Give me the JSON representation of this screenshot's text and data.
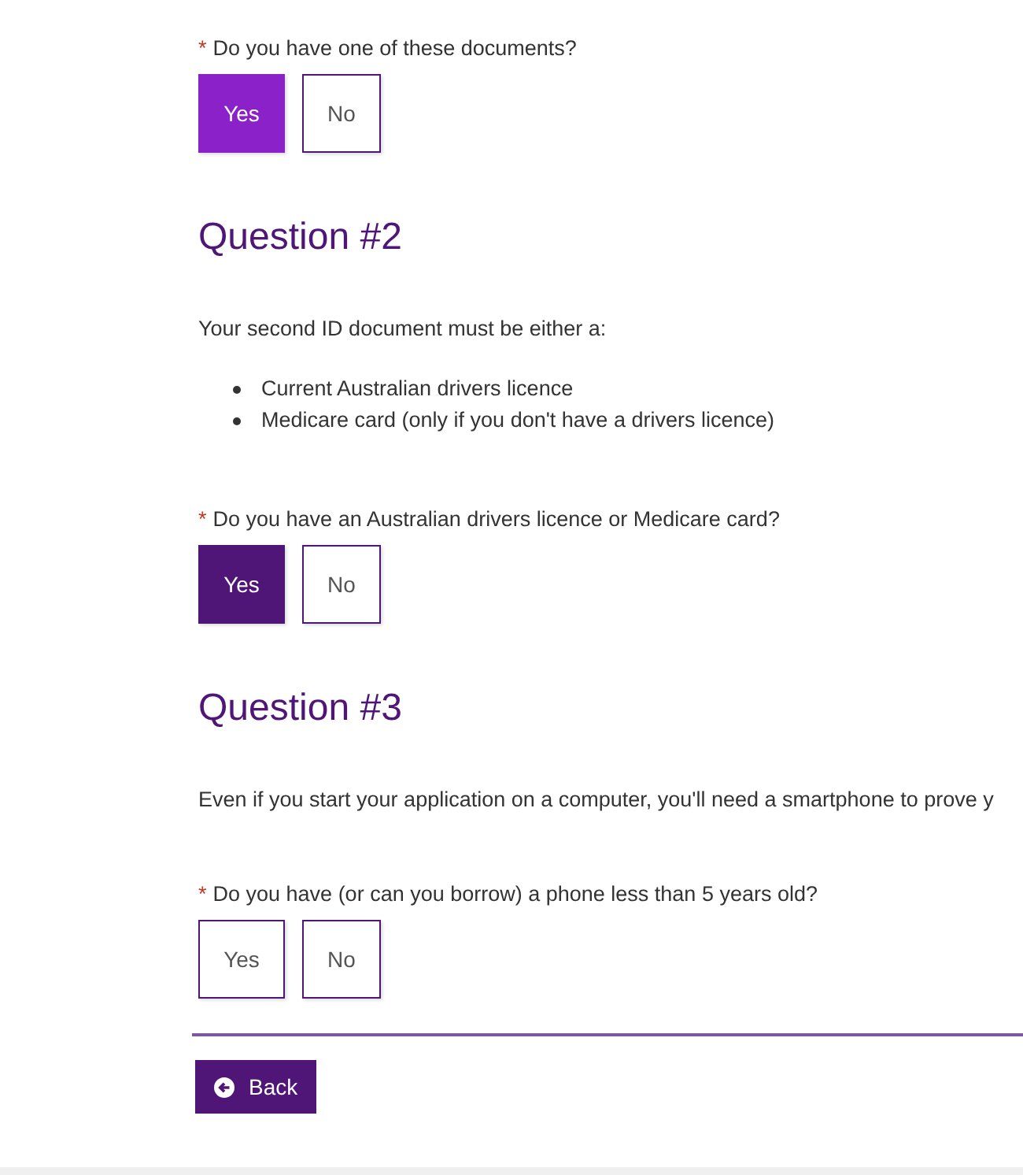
{
  "sections": [
    {
      "question": {
        "required_mark": "*",
        "text": "Do you have one of these documents?",
        "options": [
          {
            "label": "Yes",
            "selected": true,
            "hovered": true
          },
          {
            "label": "No",
            "selected": false,
            "hovered": false
          }
        ]
      }
    },
    {
      "heading": "Question #2",
      "intro": "Your second ID document must be either a:",
      "list": [
        "Current Australian drivers licence",
        "Medicare card (only if you don't have a drivers licence)"
      ],
      "question": {
        "required_mark": "*",
        "text": "Do you have an Australian drivers licence or Medicare card?",
        "options": [
          {
            "label": "Yes",
            "selected": true,
            "hovered": false
          },
          {
            "label": "No",
            "selected": false,
            "hovered": false
          }
        ]
      }
    },
    {
      "heading": "Question #3",
      "intro": "Even if you start your application on a computer, you'll need a smartphone to prove y",
      "question": {
        "required_mark": "*",
        "text": "Do you have (or can you borrow) a phone less than 5 years old?",
        "options": [
          {
            "label": "Yes",
            "selected": false,
            "hovered": false
          },
          {
            "label": "No",
            "selected": false,
            "hovered": false
          }
        ]
      }
    }
  ],
  "back_button": {
    "label": "Back"
  }
}
